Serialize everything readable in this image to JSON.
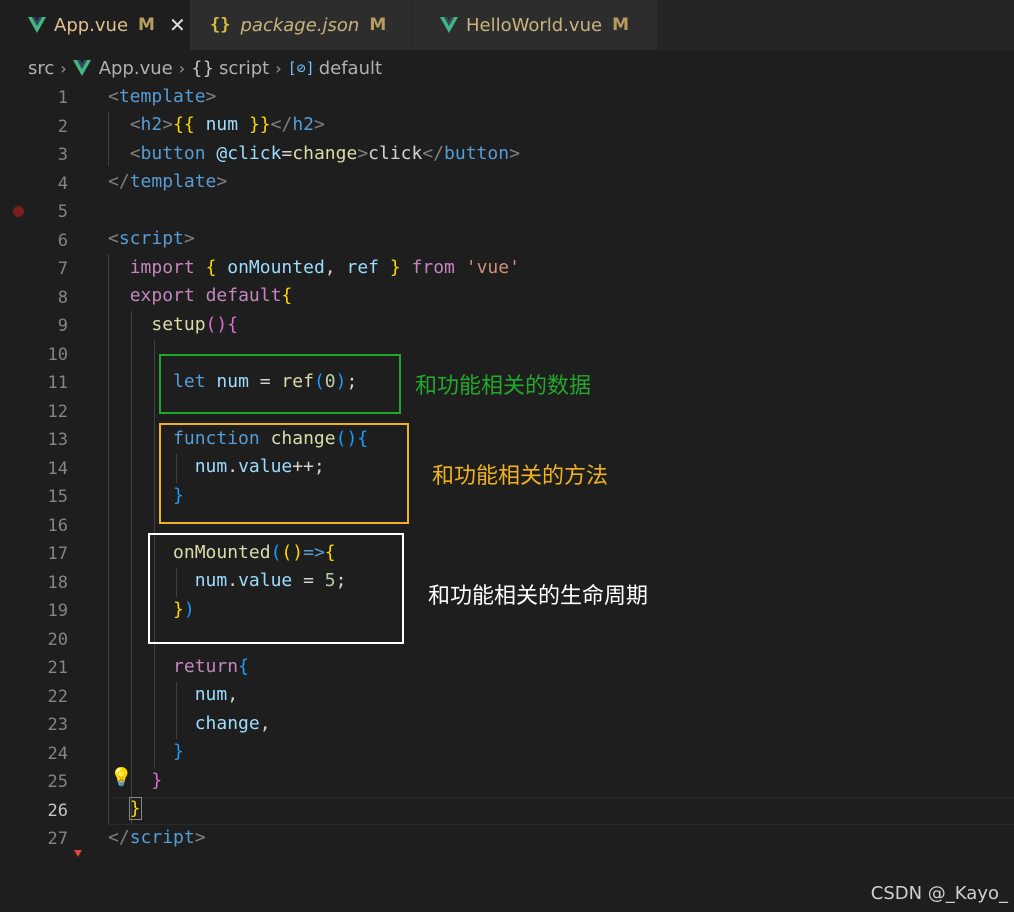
{
  "tabs": [
    {
      "name": "App.vue",
      "modified": "M",
      "icon": "vue-icon",
      "active": true
    },
    {
      "name": "package.json",
      "modified": "M",
      "icon": "json-braces-icon",
      "active": false
    },
    {
      "name": "HelloWorld.vue",
      "modified": "M",
      "icon": "vue-icon",
      "active": false
    }
  ],
  "close_glyph": "✕",
  "json_icon_glyph": "{}",
  "breadcrumb": {
    "folder": "src",
    "file": "App.vue",
    "section": "script",
    "section_glyph": "{}",
    "symbol": "default",
    "symbol_glyph": "[⊘]",
    "separator": "›"
  },
  "line_numbers": [
    "1",
    "2",
    "3",
    "4",
    "5",
    "6",
    "7",
    "8",
    "9",
    "10",
    "11",
    "12",
    "13",
    "14",
    "15",
    "16",
    "17",
    "18",
    "19",
    "20",
    "21",
    "22",
    "23",
    "24",
    "25",
    "26",
    "27"
  ],
  "current_line": "26",
  "annotations": {
    "data": "和功能相关的数据",
    "method": "和功能相关的方法",
    "lifecycle": "和功能相关的生命周期"
  },
  "colors": {
    "box_data": "#1ea52a",
    "box_method": "#f0b21a",
    "box_lifecycle": "#ffffff",
    "annot_data": "#23a82c",
    "annot_method": "#f2b21e",
    "annot_lifecycle": "#ffffff"
  },
  "watermark": "CSDN @_Kayo_"
}
